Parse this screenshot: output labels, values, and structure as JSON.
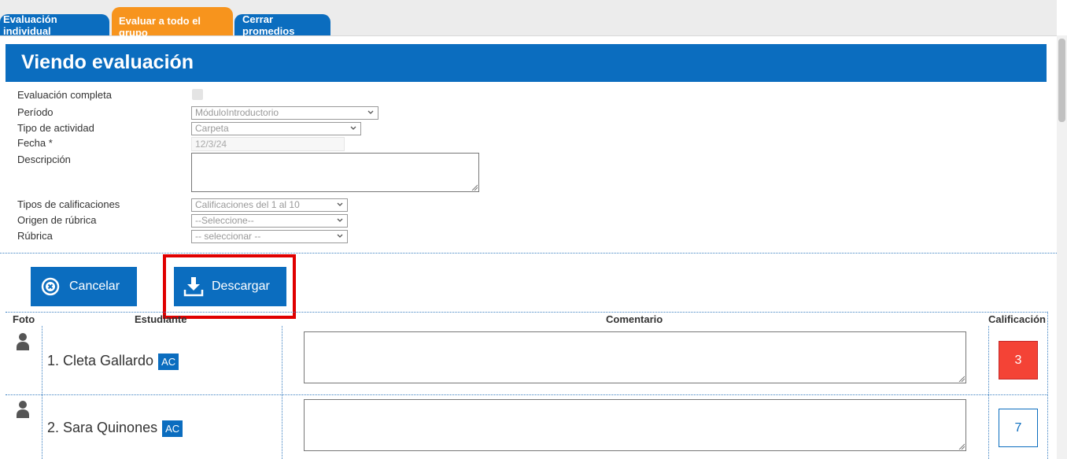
{
  "tabs": [
    {
      "label": "Evaluación individual"
    },
    {
      "label": "Evaluar a todo el grupo"
    },
    {
      "label": "Cerrar promedios"
    }
  ],
  "header": {
    "title": "Viendo evaluación"
  },
  "form": {
    "evaluacion_completa_label": "Evaluación completa",
    "periodo_label": "Período",
    "periodo_value": "MóduloIntroductorio",
    "tipo_actividad_label": "Tipo de actividad",
    "tipo_actividad_value": "Carpeta",
    "fecha_label": "Fecha",
    "fecha_required": "*",
    "fecha_value": "12/3/24",
    "descripcion_label": "Descripción",
    "tipos_calificaciones_label": "Tipos de calificaciones",
    "tipos_calificaciones_value": "Calificaciones del 1 al 10",
    "origen_rubrica_label": "Origen de rúbrica",
    "origen_rubrica_value": "--Seleccione--",
    "rubrica_label": "Rúbrica",
    "rubrica_value": "-- seleccionar --"
  },
  "buttons": {
    "cancel": "Cancelar",
    "download": "Descargar"
  },
  "table": {
    "headers": {
      "foto": "Foto",
      "estudiante": "Estudiante",
      "comentario": "Comentario",
      "calificacion": "Calificación"
    },
    "rows": [
      {
        "name": "1. Cleta Gallardo",
        "badge": "AC",
        "grade": "3",
        "grade_color": "#f44336"
      },
      {
        "name": "2. Sara Quinones",
        "badge": "AC",
        "grade": "7",
        "grade_color": "#ffffff"
      }
    ]
  },
  "colors": {
    "primary": "#0b6dbf",
    "active_tab": "#f7941d",
    "highlight": "#e00000"
  },
  "icons": {
    "cancel": "close-circle-icon",
    "download": "download-icon",
    "avatar": "user-avatar-icon",
    "dropdown": "chevron-down-icon"
  }
}
